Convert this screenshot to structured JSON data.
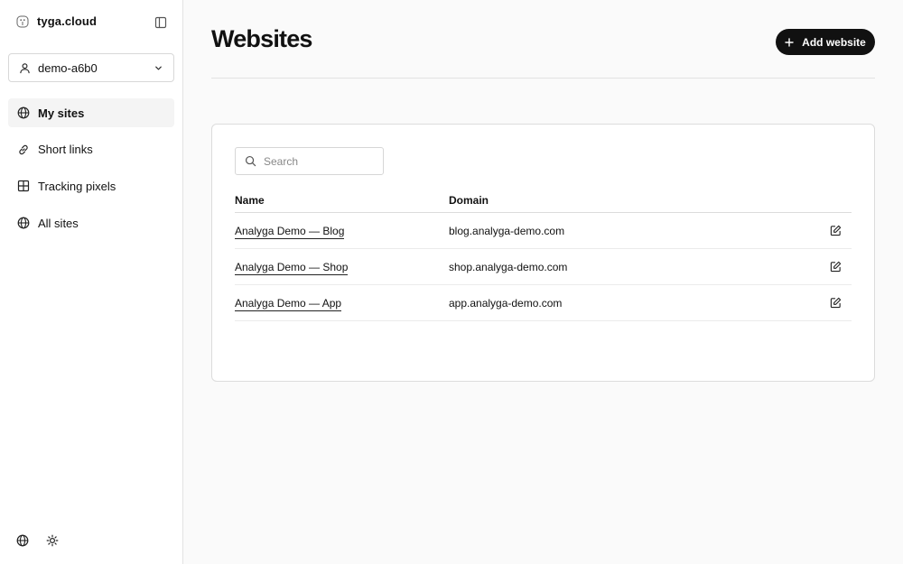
{
  "sidebar": {
    "brand": "tyga.cloud",
    "workspace": "demo-a6b0",
    "nav": [
      {
        "label": "My sites",
        "icon": "globe-icon",
        "active": true
      },
      {
        "label": "Short links",
        "icon": "link-icon",
        "active": false
      },
      {
        "label": "Tracking pixels",
        "icon": "grid-icon",
        "active": false
      },
      {
        "label": "All sites",
        "icon": "globe-icon",
        "active": false
      }
    ],
    "footer_icons": [
      "language-globe-icon",
      "sun-icon"
    ]
  },
  "main": {
    "title": "Websites",
    "add_button_label": "Add website",
    "search_placeholder": "Search",
    "columns": {
      "name": "Name",
      "domain": "Domain"
    },
    "rows": [
      {
        "name": "Analyga Demo — Blog",
        "domain": "blog.analyga-demo.com"
      },
      {
        "name": "Analyga Demo — Shop",
        "domain": "shop.analyga-demo.com"
      },
      {
        "name": "Analyga Demo — App",
        "domain": "app.analyga-demo.com"
      }
    ]
  },
  "colors": {
    "accent": "#111111",
    "border": "#dcdcdc",
    "background": "#fafafa"
  }
}
